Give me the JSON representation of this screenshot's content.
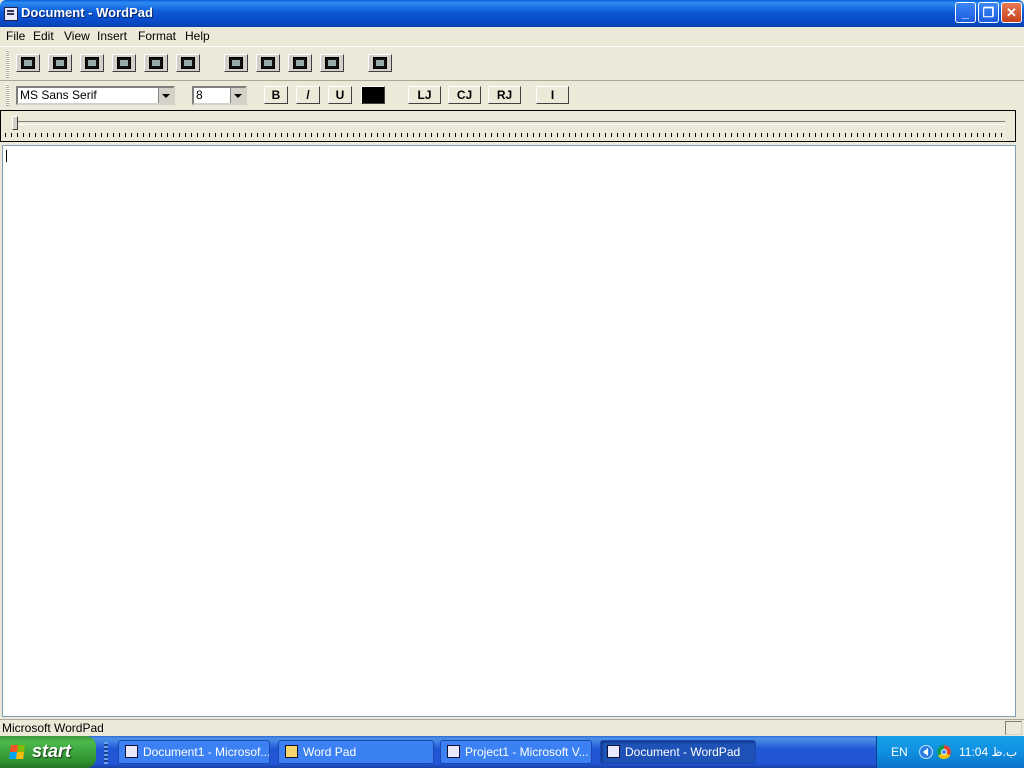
{
  "window": {
    "title": "Document - WordPad",
    "controls": {
      "minimize": "_",
      "restore": "❐",
      "close": "✕"
    }
  },
  "menu": [
    "File",
    "Edit",
    "View",
    "Insert",
    "Format",
    "Help"
  ],
  "toolbar": {
    "buttons": [
      "new-icon",
      "open-icon",
      "save-icon",
      "print-icon",
      "print-preview-icon",
      "find-icon",
      "cut-icon",
      "copy-icon",
      "paste-icon",
      "undo-icon",
      "insert-object-icon"
    ]
  },
  "format_bar": {
    "font_name": "MS Sans Serif",
    "font_size": "8",
    "bold": "B",
    "italic": "/",
    "underline": "U",
    "color": "#000000",
    "align_left": "LJ",
    "align_center": "CJ",
    "align_right": "RJ",
    "bullet": "I"
  },
  "document": {
    "text": ""
  },
  "status": {
    "text": "Microsoft WordPad"
  },
  "taskbar": {
    "start": "start",
    "tasks": [
      {
        "label": "Document1 - Microsof...",
        "active": false
      },
      {
        "label": "Word Pad",
        "active": false
      },
      {
        "label": "Project1 - Microsoft V...",
        "active": false
      },
      {
        "label": "Document - WordPad",
        "active": true
      }
    ],
    "tray": {
      "language": "EN",
      "clock": "11:04 ب.ظ"
    }
  }
}
